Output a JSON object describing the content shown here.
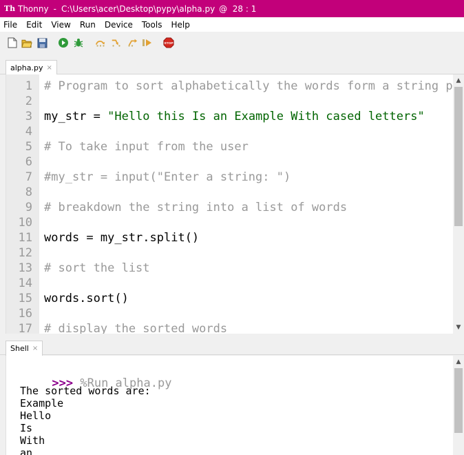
{
  "window": {
    "app_name": "Thonny",
    "separator": "-",
    "file_path": "C:\\Users\\acer\\Desktop\\pypy\\alpha.py",
    "cursor": "@  28 : 1",
    "app_icon": "thonny-icon",
    "accent_color": "#c2007a"
  },
  "menu": [
    "File",
    "Edit",
    "View",
    "Run",
    "Device",
    "Tools",
    "Help"
  ],
  "toolbar": {
    "buttons": [
      {
        "name": "new-icon"
      },
      {
        "name": "open-icon"
      },
      {
        "name": "save-icon"
      },
      {
        "name": "run-icon"
      },
      {
        "name": "debug-icon"
      },
      {
        "name": "step-over-icon"
      },
      {
        "name": "step-into-icon"
      },
      {
        "name": "step-out-icon"
      },
      {
        "name": "resume-icon"
      },
      {
        "name": "stop-icon",
        "label": "STOP"
      }
    ]
  },
  "editor": {
    "tab": {
      "label": "alpha.py",
      "close": "×"
    },
    "lines": [
      {
        "n": "1",
        "text": "# Program to sort alphabetically the words form a string pr",
        "kind": "comment"
      },
      {
        "n": "2",
        "text": "",
        "kind": "plain"
      },
      {
        "n": "3",
        "text": "my_str = ",
        "string": "\"Hello this Is an Example With cased letters\"",
        "kind": "mixed"
      },
      {
        "n": "4",
        "text": "",
        "kind": "plain"
      },
      {
        "n": "5",
        "text": "# To take input from the user",
        "kind": "comment"
      },
      {
        "n": "6",
        "text": "",
        "kind": "plain"
      },
      {
        "n": "7",
        "text": "#my_str = input(\"Enter a string: \")",
        "kind": "comment"
      },
      {
        "n": "8",
        "text": "",
        "kind": "plain"
      },
      {
        "n": "9",
        "text": "# breakdown the string into a list of words",
        "kind": "comment"
      },
      {
        "n": "10",
        "text": "",
        "kind": "plain"
      },
      {
        "n": "11",
        "text": "words = my_str.split()",
        "kind": "plain"
      },
      {
        "n": "12",
        "text": "",
        "kind": "plain"
      },
      {
        "n": "13",
        "text": "# sort the list",
        "kind": "comment"
      },
      {
        "n": "14",
        "text": "",
        "kind": "plain"
      },
      {
        "n": "15",
        "text": "words.sort()",
        "kind": "plain"
      },
      {
        "n": "16",
        "text": "",
        "kind": "plain"
      },
      {
        "n": "17",
        "text": "# display the sorted words",
        "kind": "comment"
      }
    ]
  },
  "shell": {
    "tab": {
      "label": "Shell",
      "close": "×"
    },
    "prompt": ">>>",
    "command": " %Run alpha.py",
    "output": [
      "The sorted words are:",
      "Example",
      "Hello",
      "Is",
      "With",
      "an"
    ]
  },
  "colors": {
    "comment": "#999999",
    "string": "#006400",
    "prompt": "#8b008b"
  }
}
